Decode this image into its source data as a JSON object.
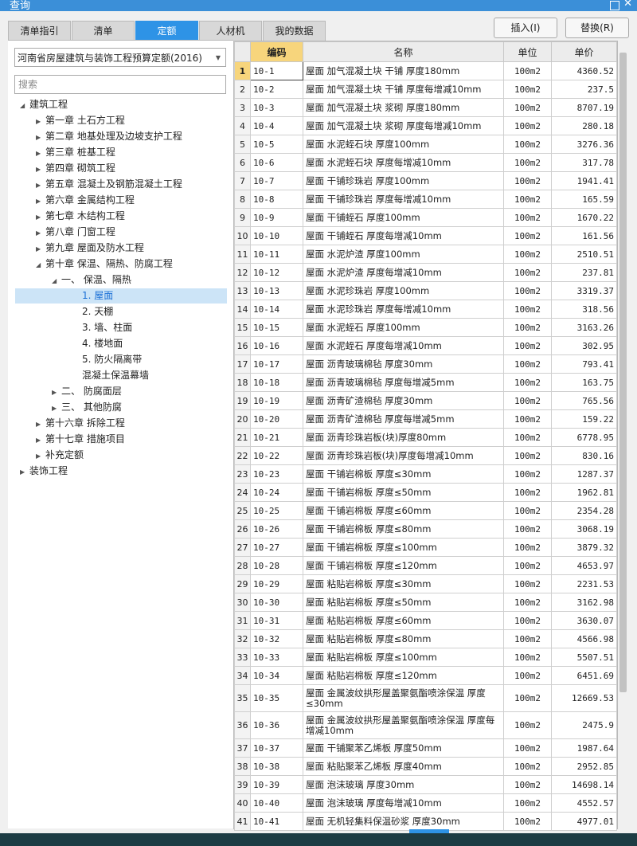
{
  "window": {
    "title": "查询"
  },
  "tabs": [
    {
      "label": "清单指引"
    },
    {
      "label": "清单"
    },
    {
      "label": "定额",
      "active": true
    },
    {
      "label": "人材机"
    },
    {
      "label": "我的数据"
    }
  ],
  "toolbar": {
    "insert_label": "插入(I)",
    "replace_label": "替换(R)"
  },
  "quota_select": {
    "value": "河南省房屋建筑与装饰工程预算定额(2016)"
  },
  "search": {
    "placeholder": "搜索"
  },
  "tree": [
    {
      "label": "建筑工程",
      "level": 0,
      "state": "expanded"
    },
    {
      "label": "第一章 土石方工程",
      "level": 1,
      "state": "collapsed"
    },
    {
      "label": "第二章 地基处理及边坡支护工程",
      "level": 1,
      "state": "collapsed"
    },
    {
      "label": "第三章 桩基工程",
      "level": 1,
      "state": "collapsed"
    },
    {
      "label": "第四章 砌筑工程",
      "level": 1,
      "state": "collapsed"
    },
    {
      "label": "第五章 混凝土及钢筋混凝土工程",
      "level": 1,
      "state": "collapsed"
    },
    {
      "label": "第六章 金属结构工程",
      "level": 1,
      "state": "collapsed"
    },
    {
      "label": "第七章 木结构工程",
      "level": 1,
      "state": "collapsed"
    },
    {
      "label": "第八章 门窗工程",
      "level": 1,
      "state": "collapsed"
    },
    {
      "label": "第九章 屋面及防水工程",
      "level": 1,
      "state": "collapsed"
    },
    {
      "label": "第十章 保温、隔热、防腐工程",
      "level": 1,
      "state": "expanded"
    },
    {
      "label": "一、 保温、隔热",
      "level": 2,
      "state": "expanded"
    },
    {
      "label": "1. 屋面",
      "level": 3,
      "state": "leaf",
      "selected": true
    },
    {
      "label": "2. 天棚",
      "level": 3,
      "state": "leaf"
    },
    {
      "label": "3. 墙、柱面",
      "level": 3,
      "state": "leaf"
    },
    {
      "label": "4. 楼地面",
      "level": 3,
      "state": "leaf"
    },
    {
      "label": "5. 防火隔离带",
      "level": 3,
      "state": "leaf"
    },
    {
      "label": "混凝土保温幕墙",
      "level": 3,
      "state": "leaf"
    },
    {
      "label": "二、 防腐面层",
      "level": 2,
      "state": "collapsed"
    },
    {
      "label": "三、 其他防腐",
      "level": 2,
      "state": "collapsed"
    },
    {
      "label": "第十六章 拆除工程",
      "level": 1,
      "state": "collapsed"
    },
    {
      "label": "第十七章 措施项目",
      "level": 1,
      "state": "collapsed"
    },
    {
      "label": "补充定额",
      "level": 1,
      "state": "collapsed"
    },
    {
      "label": "装饰工程",
      "level": 0,
      "state": "collapsed"
    }
  ],
  "grid": {
    "columns": {
      "code": "编码",
      "name": "名称",
      "unit": "单位",
      "price": "单价"
    },
    "rows": [
      {
        "no": "1",
        "code": "10-1",
        "name": "屋面 加气混凝土块 干铺 厚度180mm",
        "unit": "100m2",
        "price": "4360.52"
      },
      {
        "no": "2",
        "code": "10-2",
        "name": "屋面 加气混凝土块 干铺 厚度每增减10mm",
        "unit": "100m2",
        "price": "237.5"
      },
      {
        "no": "3",
        "code": "10-3",
        "name": "屋面 加气混凝土块 浆砌 厚度180mm",
        "unit": "100m2",
        "price": "8707.19"
      },
      {
        "no": "4",
        "code": "10-4",
        "name": "屋面 加气混凝土块 浆砌 厚度每增减10mm",
        "unit": "100m2",
        "price": "280.18"
      },
      {
        "no": "5",
        "code": "10-5",
        "name": "屋面 水泥蛭石块 厚度100mm",
        "unit": "100m2",
        "price": "3276.36"
      },
      {
        "no": "6",
        "code": "10-6",
        "name": "屋面 水泥蛭石块 厚度每增减10mm",
        "unit": "100m2",
        "price": "317.78"
      },
      {
        "no": "7",
        "code": "10-7",
        "name": "屋面 干铺珍珠岩 厚度100mm",
        "unit": "100m2",
        "price": "1941.41"
      },
      {
        "no": "8",
        "code": "10-8",
        "name": "屋面 干铺珍珠岩 厚度每增减10mm",
        "unit": "100m2",
        "price": "165.59"
      },
      {
        "no": "9",
        "code": "10-9",
        "name": "屋面 干铺蛭石 厚度100mm",
        "unit": "100m2",
        "price": "1670.22"
      },
      {
        "no": "10",
        "code": "10-10",
        "name": "屋面 干铺蛭石 厚度每增减10mm",
        "unit": "100m2",
        "price": "161.56"
      },
      {
        "no": "11",
        "code": "10-11",
        "name": "屋面 水泥炉渣 厚度100mm",
        "unit": "100m2",
        "price": "2510.51"
      },
      {
        "no": "12",
        "code": "10-12",
        "name": "屋面 水泥炉渣 厚度每增减10mm",
        "unit": "100m2",
        "price": "237.81"
      },
      {
        "no": "13",
        "code": "10-13",
        "name": "屋面 水泥珍珠岩 厚度100mm",
        "unit": "100m2",
        "price": "3319.37"
      },
      {
        "no": "14",
        "code": "10-14",
        "name": "屋面 水泥珍珠岩 厚度每增减10mm",
        "unit": "100m2",
        "price": "318.56"
      },
      {
        "no": "15",
        "code": "10-15",
        "name": "屋面 水泥蛭石 厚度100mm",
        "unit": "100m2",
        "price": "3163.26"
      },
      {
        "no": "16",
        "code": "10-16",
        "name": "屋面 水泥蛭石 厚度每增减10mm",
        "unit": "100m2",
        "price": "302.95"
      },
      {
        "no": "17",
        "code": "10-17",
        "name": "屋面 沥青玻璃棉毡 厚度30mm",
        "unit": "100m2",
        "price": "793.41"
      },
      {
        "no": "18",
        "code": "10-18",
        "name": "屋面 沥青玻璃棉毡 厚度每增减5mm",
        "unit": "100m2",
        "price": "163.75"
      },
      {
        "no": "19",
        "code": "10-19",
        "name": "屋面 沥青矿渣棉毡 厚度30mm",
        "unit": "100m2",
        "price": "765.56"
      },
      {
        "no": "20",
        "code": "10-20",
        "name": "屋面 沥青矿渣棉毡 厚度每增减5mm",
        "unit": "100m2",
        "price": "159.22"
      },
      {
        "no": "21",
        "code": "10-21",
        "name": "屋面 沥青珍珠岩板(块)厚度80mm",
        "unit": "100m2",
        "price": "6778.95"
      },
      {
        "no": "22",
        "code": "10-22",
        "name": "屋面 沥青珍珠岩板(块)厚度每增减10mm",
        "unit": "100m2",
        "price": "830.16"
      },
      {
        "no": "23",
        "code": "10-23",
        "name": "屋面 干铺岩棉板 厚度≤30mm",
        "unit": "100m2",
        "price": "1287.37"
      },
      {
        "no": "24",
        "code": "10-24",
        "name": "屋面 干铺岩棉板 厚度≤50mm",
        "unit": "100m2",
        "price": "1962.81"
      },
      {
        "no": "25",
        "code": "10-25",
        "name": "屋面 干铺岩棉板 厚度≤60mm",
        "unit": "100m2",
        "price": "2354.28"
      },
      {
        "no": "26",
        "code": "10-26",
        "name": "屋面 干铺岩棉板 厚度≤80mm",
        "unit": "100m2",
        "price": "3068.19"
      },
      {
        "no": "27",
        "code": "10-27",
        "name": "屋面 干铺岩棉板 厚度≤100mm",
        "unit": "100m2",
        "price": "3879.32"
      },
      {
        "no": "28",
        "code": "10-28",
        "name": "屋面 干铺岩棉板 厚度≤120mm",
        "unit": "100m2",
        "price": "4653.97"
      },
      {
        "no": "29",
        "code": "10-29",
        "name": "屋面 粘贴岩棉板 厚度≤30mm",
        "unit": "100m2",
        "price": "2231.53"
      },
      {
        "no": "30",
        "code": "10-30",
        "name": "屋面 粘贴岩棉板 厚度≤50mm",
        "unit": "100m2",
        "price": "3162.98"
      },
      {
        "no": "31",
        "code": "10-31",
        "name": "屋面 粘贴岩棉板 厚度≤60mm",
        "unit": "100m2",
        "price": "3630.07"
      },
      {
        "no": "32",
        "code": "10-32",
        "name": "屋面 粘贴岩棉板 厚度≤80mm",
        "unit": "100m2",
        "price": "4566.98"
      },
      {
        "no": "33",
        "code": "10-33",
        "name": "屋面 粘贴岩棉板 厚度≤100mm",
        "unit": "100m2",
        "price": "5507.51"
      },
      {
        "no": "34",
        "code": "10-34",
        "name": "屋面 粘贴岩棉板 厚度≤120mm",
        "unit": "100m2",
        "price": "6451.69"
      },
      {
        "no": "35",
        "code": "10-35",
        "name": "屋面 金属波纹拱形屋盖聚氨酯喷涂保温 厚度≤30mm",
        "unit": "100m2",
        "price": "12669.53",
        "tall": true
      },
      {
        "no": "36",
        "code": "10-36",
        "name": "屋面 金属波纹拱形屋盖聚氨酯喷涂保温 厚度每增减10mm",
        "unit": "100m2",
        "price": "2475.9",
        "tall": true
      },
      {
        "no": "37",
        "code": "10-37",
        "name": "屋面 干铺聚苯乙烯板 厚度50mm",
        "unit": "100m2",
        "price": "1987.64"
      },
      {
        "no": "38",
        "code": "10-38",
        "name": "屋面 粘贴聚苯乙烯板 厚度40mm",
        "unit": "100m2",
        "price": "2952.85"
      },
      {
        "no": "39",
        "code": "10-39",
        "name": "屋面 泡沫玻璃 厚度30mm",
        "unit": "100m2",
        "price": "14698.14"
      },
      {
        "no": "40",
        "code": "10-40",
        "name": "屋面 泡沫玻璃 厚度每增减10mm",
        "unit": "100m2",
        "price": "4552.57"
      },
      {
        "no": "41",
        "code": "10-41",
        "name": "屋面 无机轻集料保温砂浆 厚度30mm",
        "unit": "100m2",
        "price": "4977.01"
      }
    ]
  },
  "colors": {
    "accent": "#2e93e6",
    "selection_bg": "#cce4f7",
    "header_highlight": "#f7d57c"
  }
}
